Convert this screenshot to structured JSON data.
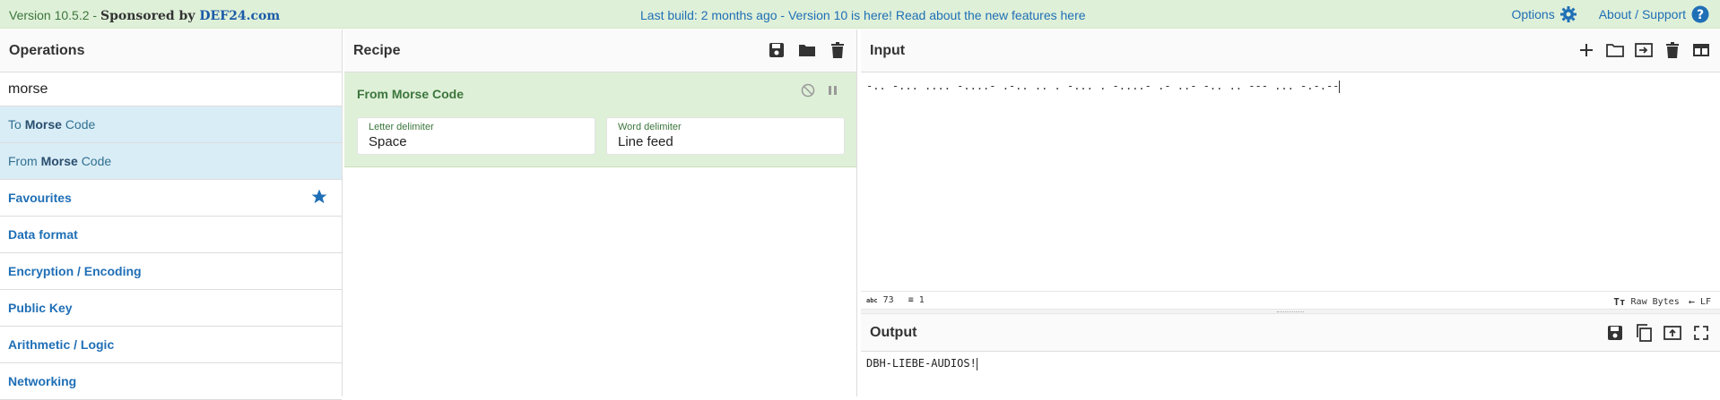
{
  "banner": {
    "version": "Version 10.5.2 - ",
    "sponsored_by": "Sponsored by ",
    "sponsor": "DEF24.com",
    "announcement": "Last build: 2 months ago - Version 10 is here! Read about the new features ",
    "announcement_link": "here",
    "options_label": "Options",
    "about_label": "About / Support"
  },
  "operations": {
    "title": "Operations",
    "search_value": "morse",
    "results": [
      {
        "prefix": "To ",
        "match": "Morse",
        "suffix": " Code"
      },
      {
        "prefix": "From ",
        "match": "Morse",
        "suffix": " Code"
      }
    ],
    "categories": [
      "Favourites",
      "Data format",
      "Encryption / Encoding",
      "Public Key",
      "Arithmetic / Logic",
      "Networking"
    ]
  },
  "recipe": {
    "title": "Recipe",
    "operation": {
      "name": "From Morse Code",
      "args": [
        {
          "label": "Letter delimiter",
          "value": "Space"
        },
        {
          "label": "Word delimiter",
          "value": "Line feed"
        }
      ]
    }
  },
  "input": {
    "title": "Input",
    "text": "-.. -... .... -....- .-.. .. . -... . -....- .- ..- -.. .. --- ... -.-.--",
    "char_count": "73",
    "line_count": "1",
    "encoding": "Raw Bytes",
    "eol": "LF"
  },
  "output": {
    "title": "Output",
    "text": "DBH-LIEBE-AUDIOS!"
  },
  "colors": {
    "accent": "#1f6fb6",
    "banner_bg": "#dff0d8",
    "highlight": "#d9edf7"
  }
}
